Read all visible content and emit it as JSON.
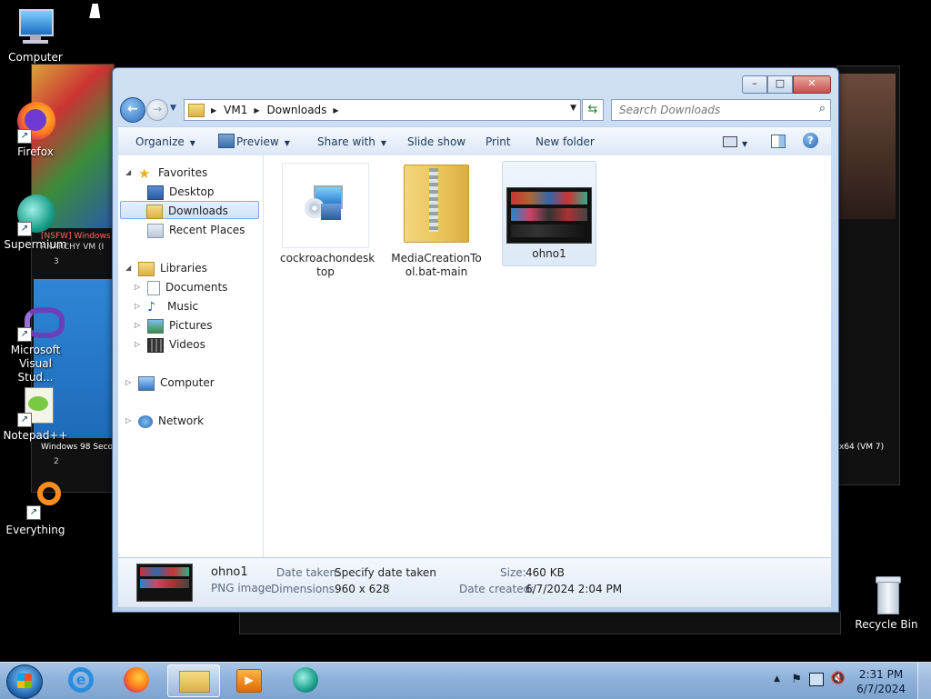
{
  "desktop": {
    "icons": [
      {
        "label": "Computer"
      },
      {
        "label": "Firefox"
      },
      {
        "label": "Supermium"
      },
      {
        "label": "Microsoft Visual Stud..."
      },
      {
        "label": "Notepad++"
      },
      {
        "label": "Everything"
      },
      {
        "label": "Recycle Bin"
      }
    ],
    "background_windows": {
      "left_thumb_1_title": "[NSFW] Windows",
      "left_thumb_1_sub": "ANARCHY VM (I",
      "left_thumb_1_count": "3",
      "left_thumb_2_title": "Windows 98 Seco",
      "left_thumb_2_count": "2",
      "right_thumb_title": "x64 (VM 7)"
    }
  },
  "window": {
    "caption": {
      "minimize": "–",
      "maximize": "□",
      "close": "✕"
    },
    "address": {
      "crumbs": [
        "VM1",
        "Downloads"
      ]
    },
    "search": {
      "placeholder": "Search Downloads"
    },
    "toolbar": {
      "organize": "Organize",
      "preview": "Preview",
      "share_with": "Share with",
      "slide_show": "Slide show",
      "print": "Print",
      "new_folder": "New folder"
    },
    "nav": {
      "favorites": "Favorites",
      "desktop": "Desktop",
      "downloads": "Downloads",
      "recent_places": "Recent Places",
      "libraries": "Libraries",
      "documents": "Documents",
      "music": "Music",
      "pictures": "Pictures",
      "videos": "Videos",
      "computer": "Computer",
      "network": "Network"
    },
    "files": [
      {
        "name_line1": "cockroachondesk",
        "name_line2": "top",
        "type": "setup-icon"
      },
      {
        "name_line1": "MediaCreationTo",
        "name_line2": "ol.bat-main",
        "type": "zip-folder-icon"
      },
      {
        "name_line1": "ohno1",
        "name_line2": "",
        "type": "image-thumbnail"
      }
    ],
    "details": {
      "name": "ohno1",
      "type": "PNG image",
      "date_taken_label": "Date taken:",
      "date_taken_value": "Specify date taken",
      "dimensions_label": "Dimensions:",
      "dimensions_value": "960 x 628",
      "size_label": "Size:",
      "size_value": "460 KB",
      "date_created_label": "Date created:",
      "date_created_value": "6/7/2024 2:04 PM"
    }
  },
  "taskbar": {
    "clock_time": "2:31 PM",
    "clock_date": "6/7/2024"
  },
  "colors": {
    "accent": "#2d6fb8",
    "selection": "#cfe3f9",
    "close_red": "#c75050"
  }
}
